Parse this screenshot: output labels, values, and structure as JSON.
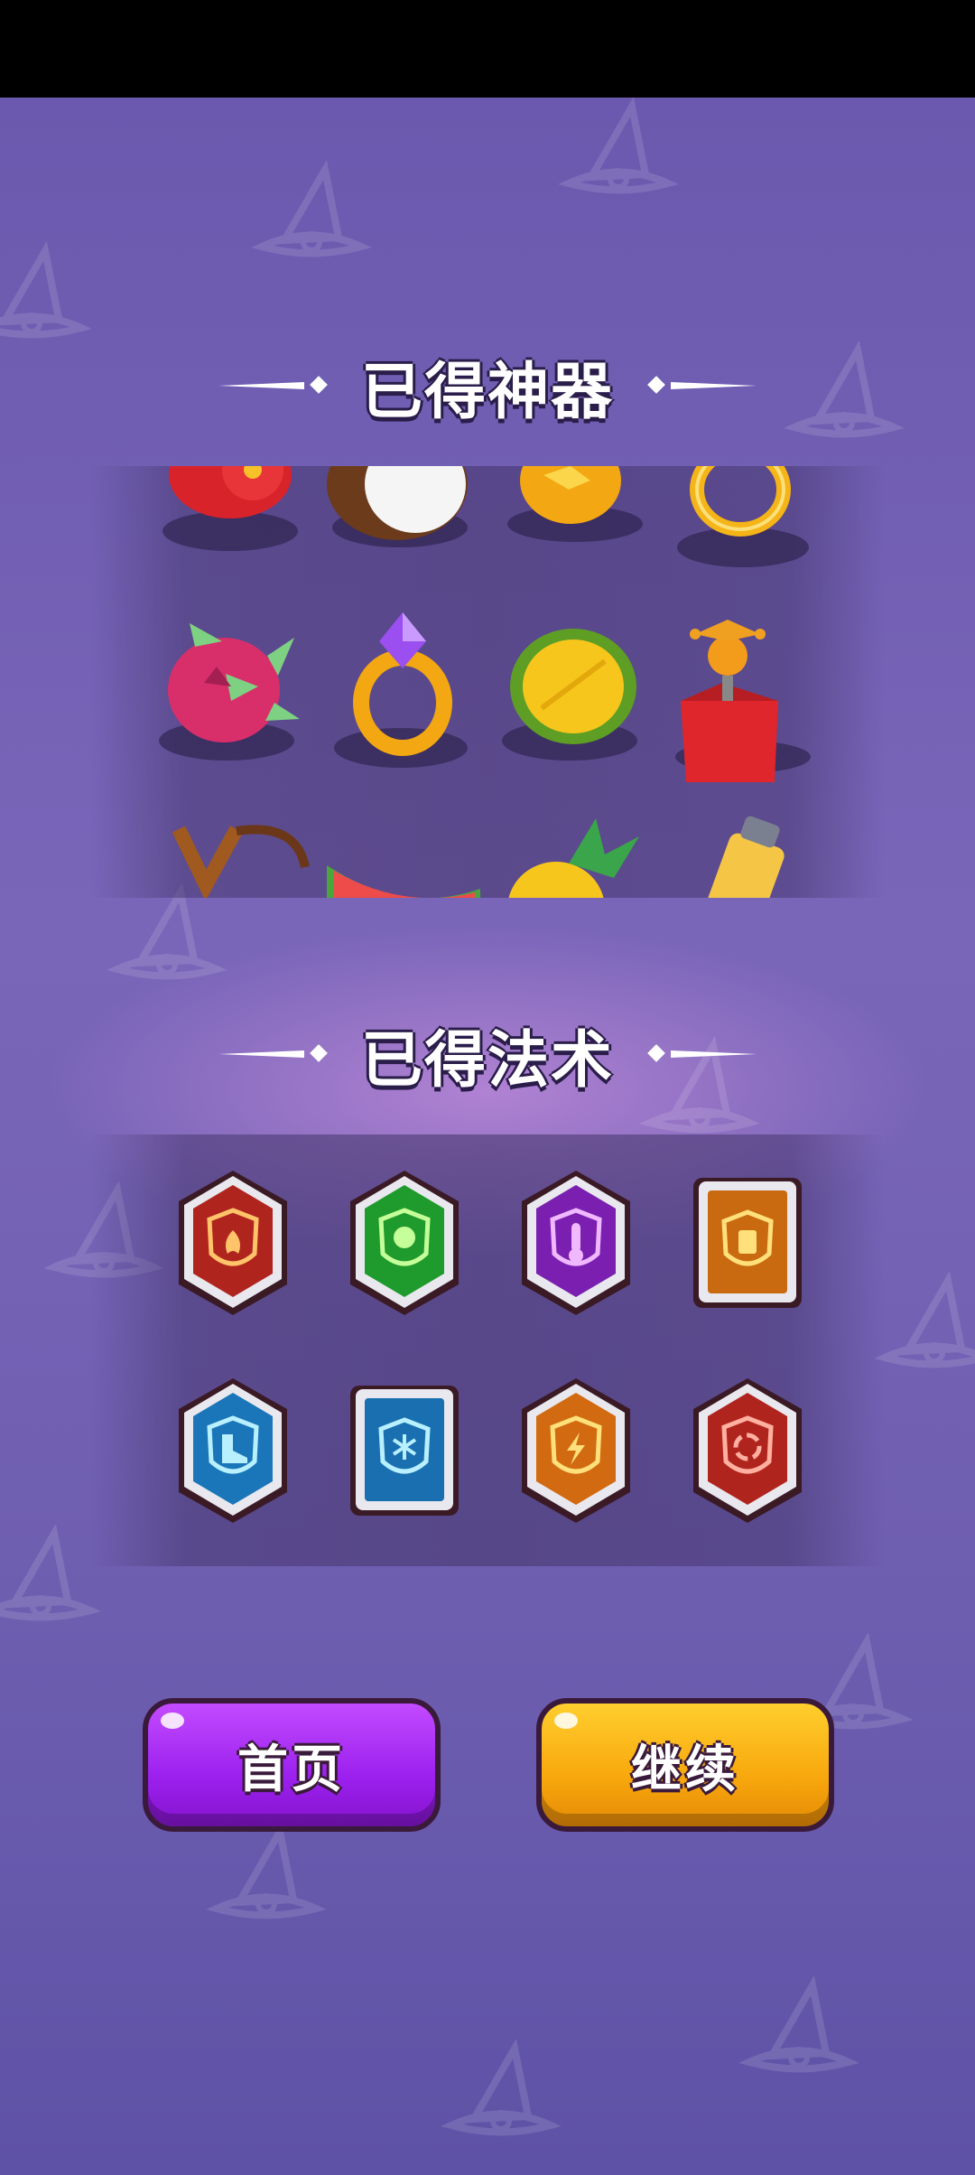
{
  "artifacts_section": {
    "title": "已得神器"
  },
  "spells_section": {
    "title": "已得法术"
  },
  "artifacts": [
    {
      "name": "tomato"
    },
    {
      "name": "coconut"
    },
    {
      "name": "lemon"
    },
    {
      "name": "gold-ring"
    },
    {
      "name": "dragon-fruit"
    },
    {
      "name": "amethyst-ring"
    },
    {
      "name": "durian"
    },
    {
      "name": "jack-in-the-box"
    },
    {
      "name": "slingshot"
    },
    {
      "name": "watermelon"
    },
    {
      "name": "pineapple"
    },
    {
      "name": "battery"
    }
  ],
  "spells": [
    {
      "name": "fire-shield",
      "color": "#b0241e"
    },
    {
      "name": "poison-shield",
      "color": "#1f9a2c"
    },
    {
      "name": "thermometer-shield",
      "color": "#7a1fb0"
    },
    {
      "name": "battery-shield",
      "color": "#c96a10"
    },
    {
      "name": "boot-shield",
      "color": "#1a76b8"
    },
    {
      "name": "ice-shield",
      "color": "#1a6fb0"
    },
    {
      "name": "lightning-shield",
      "color": "#d16a10"
    },
    {
      "name": "cycle-shield",
      "color": "#b0241e"
    }
  ],
  "buttons": {
    "home_label": "首页",
    "continue_label": "继续"
  },
  "colors": {
    "background": "#6a5aa8",
    "home_button": "#a42af0",
    "continue_button": "#f8a80d"
  }
}
